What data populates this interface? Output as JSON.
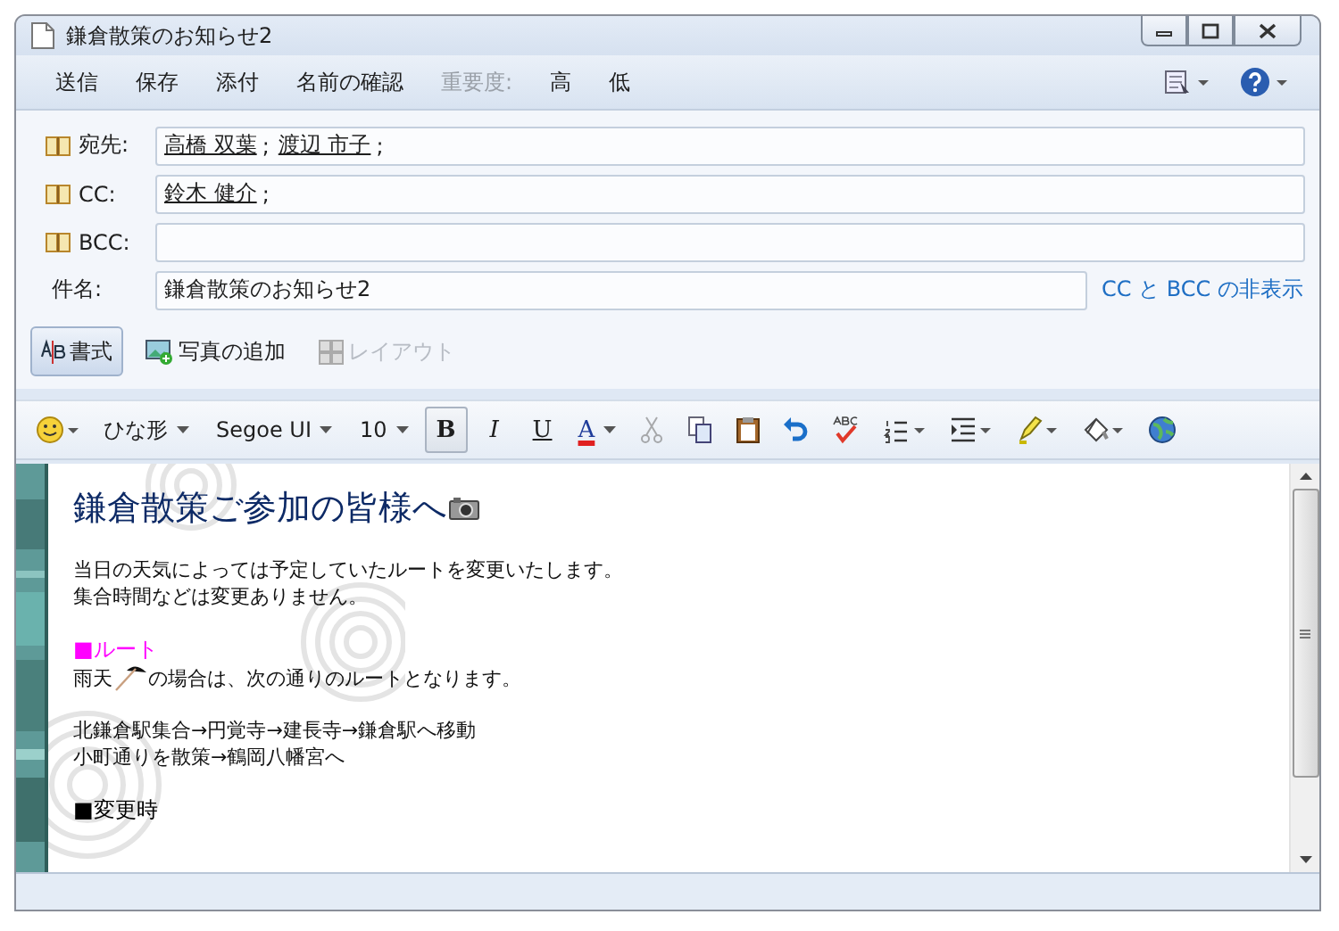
{
  "window": {
    "title": "鎌倉散策のお知らせ2"
  },
  "toolbar": {
    "items": [
      {
        "label": "送信",
        "disabled": false
      },
      {
        "label": "保存",
        "disabled": false
      },
      {
        "label": "添付",
        "disabled": false
      },
      {
        "label": "名前の確認",
        "disabled": false
      },
      {
        "label": "重要度:",
        "disabled": true
      },
      {
        "label": "高",
        "disabled": false
      },
      {
        "label": "低",
        "disabled": false
      }
    ]
  },
  "fields": [
    {
      "label": "宛先:",
      "recipients": [
        {
          "name": "高橋 双葉",
          "separator": ";"
        },
        {
          "name": "渡辺 市子",
          "separator": ";"
        }
      ]
    },
    {
      "label": "CC:",
      "recipients": [
        {
          "name": "鈴木 健介",
          "separator": ";"
        }
      ]
    },
    {
      "label": "BCC:"
    }
  ],
  "subject": {
    "label": "件名:",
    "value": "鎌倉散策のお知らせ2",
    "link": "CC と BCC の非表示"
  },
  "tabs": [
    {
      "label": "書式",
      "kind": "format",
      "selected": true,
      "disabled": false
    },
    {
      "label": "写真の追加",
      "kind": "photo",
      "selected": false,
      "disabled": false
    },
    {
      "label": "レイアウト",
      "kind": "layout",
      "selected": false,
      "disabled": true
    }
  ],
  "format_bar": {
    "template": "ひな形",
    "font": "Segoe UI",
    "size": "10",
    "styles": [
      {
        "label": "B",
        "kind": "bold",
        "selected": true
      },
      {
        "label": "I",
        "kind": "italic",
        "selected": false
      },
      {
        "label": "U",
        "kind": "underline",
        "selected": false
      }
    ],
    "font_color": {
      "label": "A"
    },
    "tools": [
      {
        "kind": "cut",
        "disabled": true
      },
      {
        "kind": "copy",
        "disabled": false
      },
      {
        "kind": "paste",
        "disabled": false
      },
      {
        "kind": "undo",
        "disabled": false
      },
      {
        "kind": "spelling",
        "disabled": false
      },
      {
        "kind": "list",
        "disabled": false
      },
      {
        "kind": "indent",
        "disabled": false
      },
      {
        "kind": "highlight",
        "disabled": false
      },
      {
        "kind": "fill",
        "disabled": false
      },
      {
        "kind": "globe",
        "disabled": false
      }
    ]
  },
  "body": [
    {
      "kind": "heading",
      "text": "鎌倉散策ご参加の皆様へ"
    },
    {
      "kind": "paragraph",
      "lines": [
        "当日の天気によっては予定していたルートを変更いたします。",
        "集合時間などは変更ありません。"
      ]
    },
    {
      "kind": "section",
      "text": "■ルート",
      "color": "#ff00ff"
    },
    {
      "kind": "umbrella_line",
      "before": "雨天",
      "after": "の場合は、次の通りのルートとなります。"
    },
    {
      "kind": "paragraph",
      "lines": [
        "北鎌倉駅集合→円覚寺→建長寺→鎌倉駅へ移動",
        "小町通りを散策→鶴岡八幡宮へ"
      ]
    },
    {
      "kind": "section",
      "text": "■変更時",
      "color": "#000000"
    }
  ]
}
